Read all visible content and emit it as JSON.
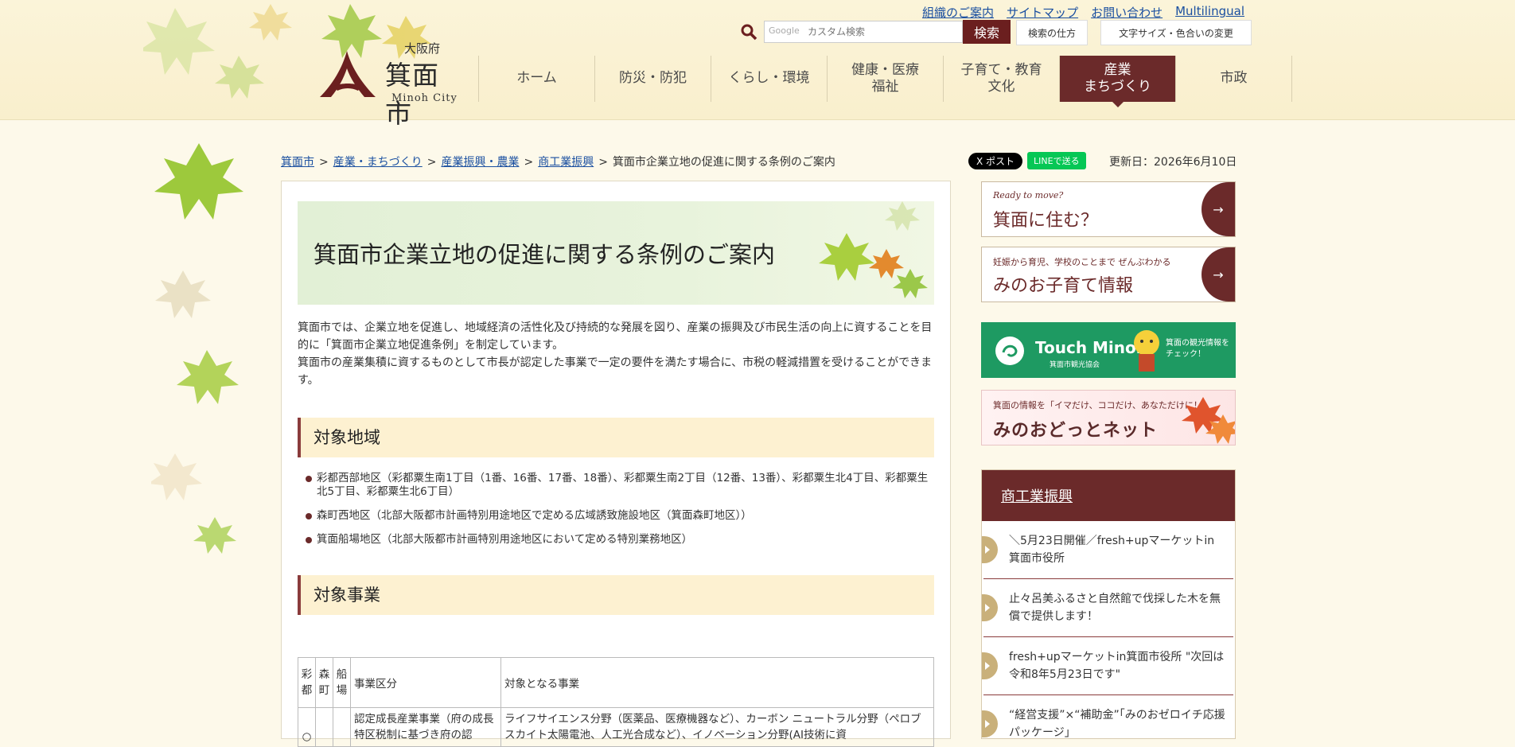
{
  "header": {
    "top_links": [
      "組織のご案内",
      "サイトマップ",
      "お問い合わせ",
      "Multilingual"
    ],
    "search_placeholder": "カスタム検索",
    "search_google": "Google",
    "search_button": "検索",
    "search_howto": "検索の仕方",
    "font_color": "文字サイズ・色合いの変更",
    "logo": {
      "pref": "大阪府",
      "city": "箕面市",
      "en": "Minoh City"
    },
    "nav": [
      {
        "label": "ホーム",
        "active": false
      },
      {
        "label": "防災・防犯",
        "active": false
      },
      {
        "label": "くらし・環境",
        "active": false
      },
      {
        "label": "健康・医療\n福祉",
        "active": false
      },
      {
        "label": "子育て・教育\n文化",
        "active": false
      },
      {
        "label": "産業\nまちづくり",
        "active": true
      },
      {
        "label": "市政",
        "active": false
      }
    ]
  },
  "breadcrumb": {
    "links": [
      "箕面市",
      "産業・まちづくり",
      "産業振興・農業",
      "商工業振興"
    ],
    "current": "箕面市企業立地の促進に関する条例のご案内",
    "sep": ">"
  },
  "share": {
    "x": "X ポスト",
    "line": "LINEで送る"
  },
  "updated": "更新日：2026年6月10日",
  "main": {
    "title": "箕面市企業立地の促進に関する条例のご案内",
    "intro": [
      "箕面市では、企業立地を促進し、地域経済の活性化及び持続的な発展を図り、産業の振興及び市民生活の向上に資することを目的に「箕面市企業立地促進条例」を制定しています。",
      "箕面市の産業集積に資するものとして市長が認定した事業で一定の要件を満たす場合に、市税の軽減措置を受けることができます。"
    ],
    "h_area": "対象地域",
    "areas": [
      "彩都西部地区（彩都粟生南1丁目（1番、16番、17番、18番）、彩都粟生南2丁目（12番、13番）、彩都粟生北4丁目、彩都粟生北5丁目、彩都粟生北6丁目）",
      "森町西地区（北部大阪都市計画特別用途地区で定める広域誘致施設地区（箕面森町地区））",
      "箕面船場地区（北部大阪都市計画特別用途地区において定める特別業務地区）"
    ],
    "h_business": "対象事業",
    "table": {
      "headers": [
        "彩都",
        "森町",
        "船場",
        "事業区分",
        "対象となる事業"
      ],
      "row1": [
        "○",
        "",
        "",
        "認定成長産業事業（府の成長特区税制に基づき府の認",
        "ライフサイエンス分野（医薬品、医療機器など）、カーボン ニュートラル分野（ペロブスカイト太陽電池、人工光合成など）、イノベーション分野(AI技術に資"
      ]
    }
  },
  "side": {
    "live": {
      "sub": "Ready to move?",
      "main": "箕面に住む？"
    },
    "kids": {
      "sub": "妊娠から育児、学校のことまで ぜんぶわかる",
      "main": "みのお子育て情報"
    },
    "touch": {
      "title": "Touch Minoh",
      "sub": "箕面市観光協会",
      "check": "箕面の観光情報を\nチェック！"
    },
    "odotto": {
      "sub": "箕面の情報を「イマだけ、ココだけ、あなただけに！」",
      "main": "みのおどっとネット"
    },
    "menu_title": "商工業振興",
    "menu_items": [
      "＼5月23日開催／fresh+upマーケットin箕面市役所",
      "止々呂美ふるさと自然館で伐採した木を無償で提供します！",
      "fresh+upマーケットin箕面市役所 \"次回は令和8年5月23日です\"",
      "“経営支援”×“補助金”「みのおゼロイチ応援パッケージ」"
    ]
  }
}
